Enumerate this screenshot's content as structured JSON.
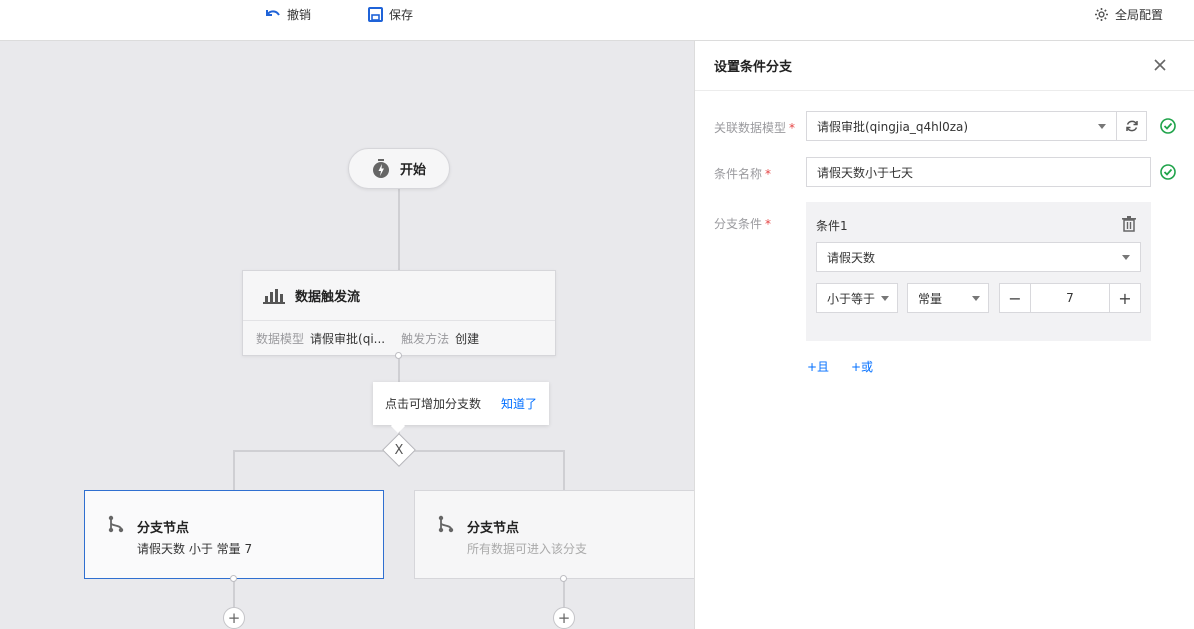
{
  "toolbar": {
    "undo_label": "撤销",
    "save_label": "保存",
    "global_config_label": "全局配置"
  },
  "canvas": {
    "start_label": "开始",
    "trigger": {
      "title": "数据触发流",
      "model_label": "数据模型",
      "model_value": "请假审批(qi...",
      "method_label": "触发方法",
      "method_value": "创建"
    },
    "tooltip": {
      "text": "点击可增加分支数",
      "action": "知道了"
    },
    "gateway_symbol": "X",
    "branches": [
      {
        "title": "分支节点",
        "subtitle": "请假天数 小于 常量 7",
        "active": true
      },
      {
        "title": "分支节点",
        "subtitle": "所有数据可进入该分支",
        "active": false
      }
    ],
    "add_symbol": "+"
  },
  "panel": {
    "title": "设置条件分支",
    "data_model": {
      "label": "关联数据模型",
      "required": "*",
      "value": "请假审批(qingjia_q4hl0za)"
    },
    "condition_name": {
      "label": "条件名称",
      "required": "*",
      "value": "请假天数小于七天"
    },
    "branch_condition": {
      "label": "分支条件",
      "required": "*",
      "group_title": "条件1",
      "field_value": "请假天数",
      "operator_value": "小于等于",
      "value_type": "常量",
      "stepper_value": "7",
      "minus": "−",
      "plus": "+"
    },
    "add_and": "+且",
    "add_or": "+或"
  },
  "colors": {
    "accent": "#006eff",
    "success": "#1fa34a",
    "required": "#e54545",
    "active_border": "#2f6fd0"
  }
}
